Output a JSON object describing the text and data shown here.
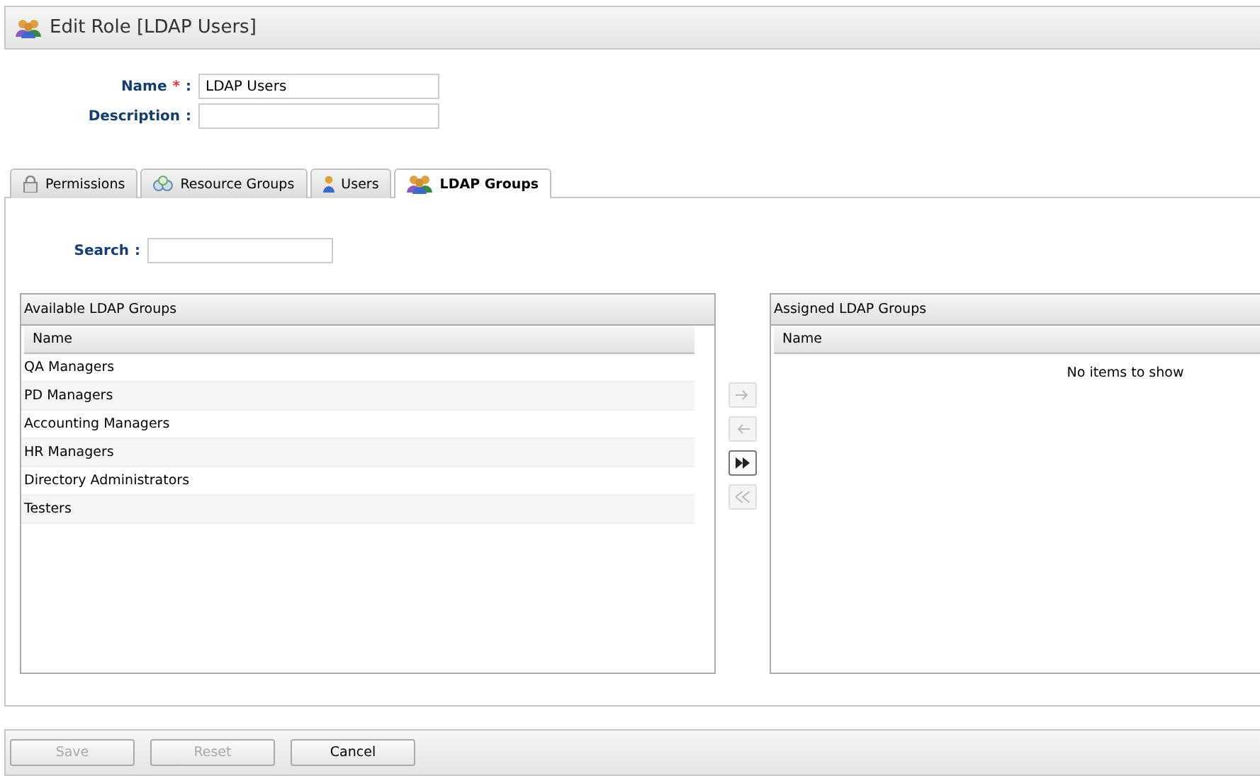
{
  "header": {
    "title": "Edit Role [LDAP Users]"
  },
  "form": {
    "fields": [
      {
        "label": "Name",
        "required_mark": "*",
        "separator": ":",
        "value": "LDAP Users"
      },
      {
        "label": "Description",
        "separator": ":"
      }
    ]
  },
  "tabs": [
    {
      "label": "Permissions",
      "kind": "lock",
      "selected": false
    },
    {
      "label": "Resource Groups",
      "kind": "circles",
      "selected": false
    },
    {
      "label": "Users",
      "kind": "user",
      "selected": false
    },
    {
      "label": "LDAP Groups",
      "kind": "group",
      "selected": true
    }
  ],
  "search": {
    "label": "Search",
    "separator": ":"
  },
  "available": {
    "title": "Available LDAP Groups",
    "column": "Name",
    "rows": [
      "QA Managers",
      "PD Managers",
      "Accounting Managers",
      "HR Managers",
      "Directory Administrators",
      "Testers"
    ]
  },
  "transfer_buttons": [
    {
      "kind": "right",
      "disabled": true
    },
    {
      "kind": "left",
      "disabled": true
    },
    {
      "kind": "all-right",
      "disabled": false
    },
    {
      "kind": "all-left",
      "disabled": true
    }
  ],
  "assigned": {
    "title": "Assigned LDAP Groups",
    "column": "Name",
    "empty": "No items to show"
  },
  "buttons": [
    {
      "label": "Save",
      "disabled": true
    },
    {
      "label": "Reset",
      "disabled": true
    },
    {
      "label": "Cancel",
      "disabled": false
    }
  ]
}
